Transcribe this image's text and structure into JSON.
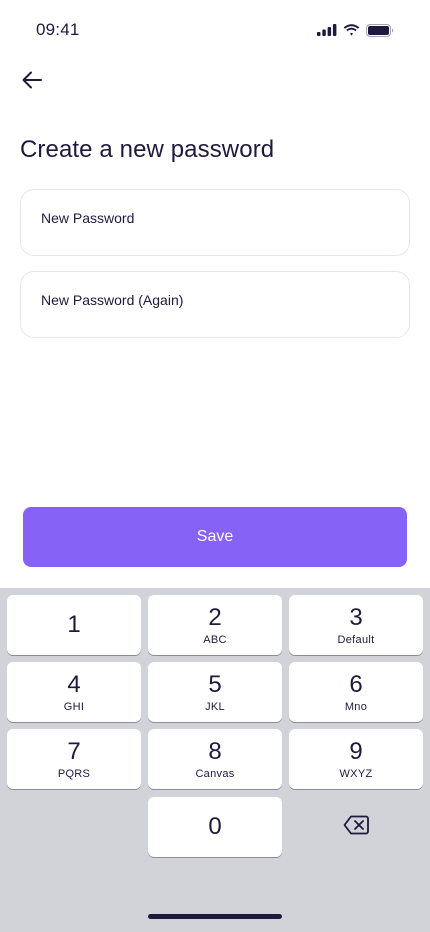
{
  "status_bar": {
    "time": "09:41"
  },
  "header": {
    "title": "Create a new password"
  },
  "form": {
    "new_password_label": "New Password",
    "new_password_value": "",
    "new_password_again_label": "New Password (Again)",
    "new_password_again_value": ""
  },
  "actions": {
    "save_label": "Save"
  },
  "keyboard": {
    "keys": [
      {
        "digit": "1",
        "letters": ""
      },
      {
        "digit": "2",
        "letters": "ABC"
      },
      {
        "digit": "3",
        "letters": "Default"
      },
      {
        "digit": "4",
        "letters": "GHI"
      },
      {
        "digit": "5",
        "letters": "JKL"
      },
      {
        "digit": "6",
        "letters": "Mno"
      },
      {
        "digit": "7",
        "letters": "PQRS"
      },
      {
        "digit": "8",
        "letters": "Canvas"
      },
      {
        "digit": "9",
        "letters": "WXYZ"
      },
      {
        "digit": "0",
        "letters": ""
      }
    ],
    "delete_icon": "backspace-icon"
  },
  "colors": {
    "accent": "#8662f6",
    "text": "#1f1a3d",
    "keyboard_bg": "#d1d3d9"
  }
}
